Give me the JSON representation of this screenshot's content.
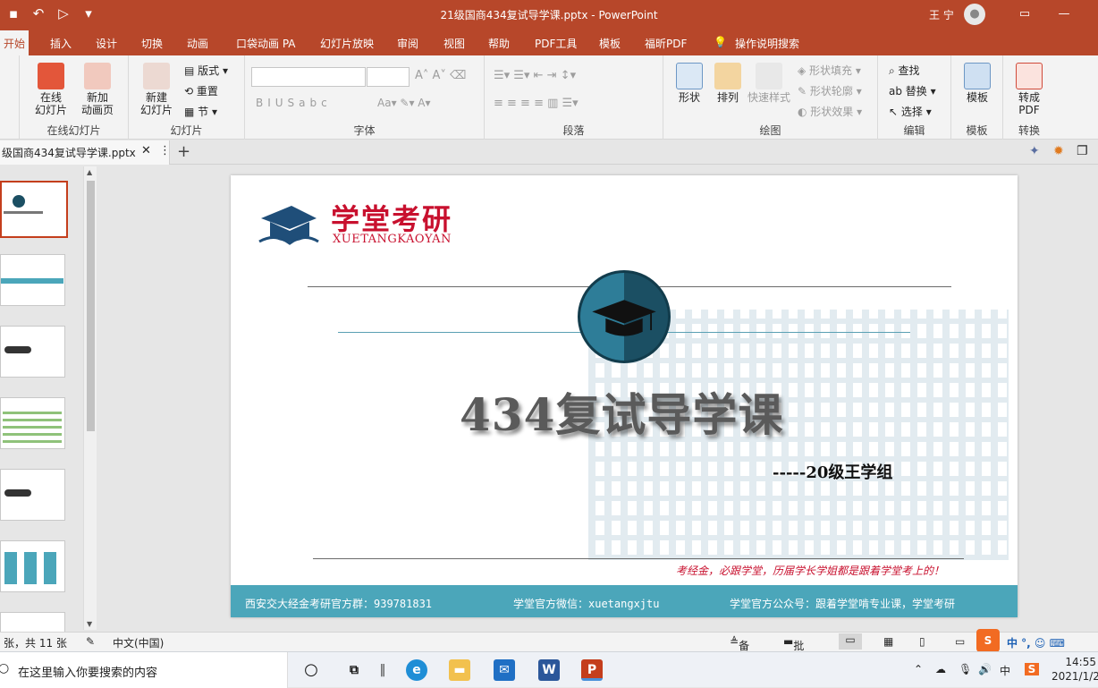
{
  "titlebar": {
    "title": "21级国商434复试导学课.pptx  -  PowerPoint",
    "user": "王 宁"
  },
  "tabs": [
    "开始",
    "插入",
    "设计",
    "切换",
    "动画",
    "口袋动画 PA",
    "幻灯片放映",
    "审阅",
    "视图",
    "帮助",
    "PDF工具",
    "模板",
    "福昕PDF",
    "操作说明搜索"
  ],
  "ribbon": {
    "online_slide": "在线\n幻灯片",
    "new_anim_page": "新加\n动画页",
    "group_online": "在线幻灯片",
    "new_slide": "新建\n幻灯片",
    "layout": "版式",
    "reset": "重置",
    "section": "节",
    "group_slides": "幻灯片",
    "group_font": "字体",
    "group_paragraph": "段落",
    "shape": "形状",
    "arrange": "排列",
    "quick_style": "快速样式",
    "shape_fill": "形状填充",
    "shape_outline": "形状轮廓",
    "shape_effect": "形状效果",
    "group_drawing": "绘图",
    "find": "查找",
    "replace": "替换",
    "select": "选择",
    "group_edit": "编辑",
    "template": "模板",
    "group_template": "模板",
    "to_pdf": "转成\nPDF",
    "group_convert": "转换"
  },
  "doc_tab": {
    "name": "级国商434复试导学课.pptx"
  },
  "slide": {
    "logo_text": "学堂考研",
    "logo_sub": "XUETANGKAOYAN",
    "title": "434复试导学课",
    "author": "-----20级王学组",
    "slogan": "考经金，必跟学堂，历届学长学姐都是跟着学堂考上的！",
    "footer": [
      "西安交大经金考研官方群：939781831",
      "学堂官方微信：xuetangxjtu",
      "学堂官方公众号：跟着学堂啃专业课，学堂考研"
    ]
  },
  "statusbar": {
    "slide_count": "张，共 11 张",
    "language": "中文(中国)",
    "notes": "备注",
    "comments": "批注"
  },
  "taskbar": {
    "search_placeholder": "在这里输入你要搜索的内容",
    "time": "14:55",
    "date": "2021/1/2",
    "ime": "中"
  },
  "colors": {
    "accent": "#b7472a",
    "footer": "#4ba6ba",
    "brand_red": "#c8102e"
  }
}
